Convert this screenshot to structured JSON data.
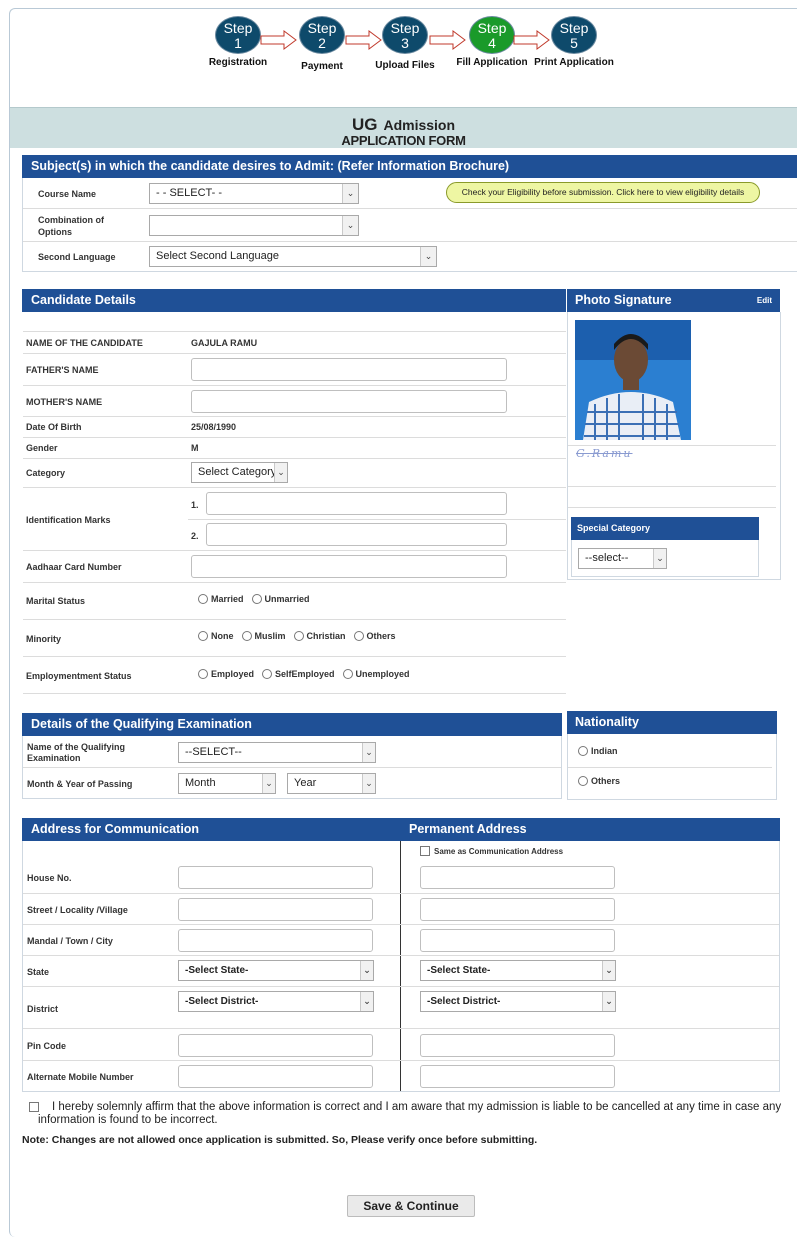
{
  "stepper": {
    "steps": [
      {
        "word": "Step",
        "num": "1",
        "label": "Registration"
      },
      {
        "word": "Step",
        "num": "2",
        "label": "Payment"
      },
      {
        "word": "Step",
        "num": "3",
        "label": "Upload Files"
      },
      {
        "word": "Step",
        "num": "4",
        "label": "Fill Application"
      },
      {
        "word": "Step",
        "num": "5",
        "label": "Print Application"
      }
    ],
    "active_color": "#1a9a2a",
    "inactive_color": "#0e4a6b"
  },
  "header": {
    "title_main": "UG",
    "title_sub": "Admission",
    "form_name": "APPLICATION FORM"
  },
  "subjects": {
    "title": "Subject(s) in which the candidate desires to Admit: (Refer Information Brochure)",
    "course_label": "Course Name",
    "course_value": "- - SELECT- -",
    "combination_label_1": "Combination of",
    "combination_label_2": "Options",
    "combination_value": "",
    "language_label": "Second Language",
    "language_value": "Select Second Language",
    "eligibility_link": "Check your Eligibility before submission. Click here to view eligibility details"
  },
  "candidate": {
    "title": "Candidate Details",
    "name_label": "NAME OF THE CANDIDATE",
    "name_value": "GAJULA RAMU",
    "father_label": "FATHER'S NAME",
    "mother_label": "MOTHER'S NAME",
    "dob_label": "Date Of Birth",
    "dob_value": "25/08/1990",
    "gender_label": "Gender",
    "gender_value": "M",
    "category_label": "Category",
    "category_value": "Select Category",
    "marks_label": "Identification Marks",
    "mark1": "1.",
    "mark2": "2.",
    "aadhaar_label": "Aadhaar Card Number",
    "marital_label": "Marital Status",
    "marital_options": [
      "Married",
      "Unmarried"
    ],
    "minority_label": "Minority",
    "minority_options": [
      "None",
      "Muslim",
      "Christian",
      "Others"
    ],
    "employment_label": "Employmentment Status",
    "employment_options": [
      "Employed",
      "SelfEmployed",
      "Unemployed"
    ]
  },
  "photo": {
    "title": "Photo Signature",
    "edit": "Edit",
    "signature_text": "G.Ramu"
  },
  "special": {
    "title": "Special Category",
    "value": "--select--"
  },
  "qualifying": {
    "title": "Details of the Qualifying Examination",
    "exam_label_1": "Name of the Qualifying",
    "exam_label_2": "Examination",
    "exam_value": "--SELECT--",
    "passing_label": "Month & Year of Passing",
    "month_value": "Month",
    "year_value": "Year"
  },
  "nationality": {
    "title": "Nationality",
    "options": [
      "Indian",
      "Others"
    ]
  },
  "address": {
    "comm_title": "Address for Communication",
    "perm_title": "Permanent Address",
    "same_as": "Same as Communication Address",
    "house_label": "House No.",
    "street_label": "Street / Locality /Village",
    "mandal_label": "Mandal / Town / City",
    "state_label": "State",
    "state_value": "-Select State-",
    "district_label": "District",
    "district_value": "-Select District-",
    "pin_label": "Pin Code",
    "mobile_label": "Alternate Mobile Number"
  },
  "declaration": {
    "line1": "I hereby solemnly affirm that the above information is correct and I am aware that my admission is liable to be cancelled at any time in case any",
    "line2": "information is found to be incorrect.",
    "note": "Note: Changes are not allowed once application is submitted. So, Please verify once before submitting."
  },
  "actions": {
    "save_label": "Save & Continue"
  }
}
